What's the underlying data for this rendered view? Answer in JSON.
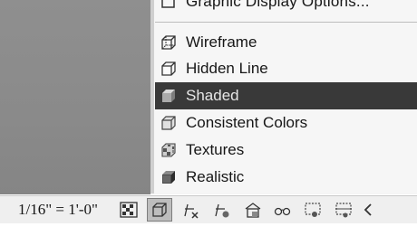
{
  "menu": {
    "top_item_label": "Graphic Display Options...",
    "items": [
      {
        "label": "Wireframe",
        "icon": "wireframe-cube-icon"
      },
      {
        "label": "Hidden Line",
        "icon": "hidden-line-cube-icon"
      },
      {
        "label": "Shaded",
        "icon": "shaded-cube-icon",
        "selected": true
      },
      {
        "label": "Consistent Colors",
        "icon": "consistent-colors-cube-icon"
      },
      {
        "label": "Textures",
        "icon": "textures-cube-icon"
      },
      {
        "label": "Realistic",
        "icon": "realistic-cube-icon"
      }
    ]
  },
  "statusbar": {
    "scale": "1/16\" = 1'-0\"",
    "icons": [
      "detail-level-icon",
      "visual-style-icon",
      "sun-path-icon",
      "shadows-icon",
      "show-rendering-icon",
      "temporary-hide-icon",
      "reveal-hidden-icon",
      "crop-view-icon",
      "show-crop-region-icon",
      "scroll-left-icon"
    ]
  },
  "colors": {
    "selected_bg": "#393939",
    "menu_bg": "#f6f6f6",
    "viewport_bg": "#8a8a8a"
  }
}
